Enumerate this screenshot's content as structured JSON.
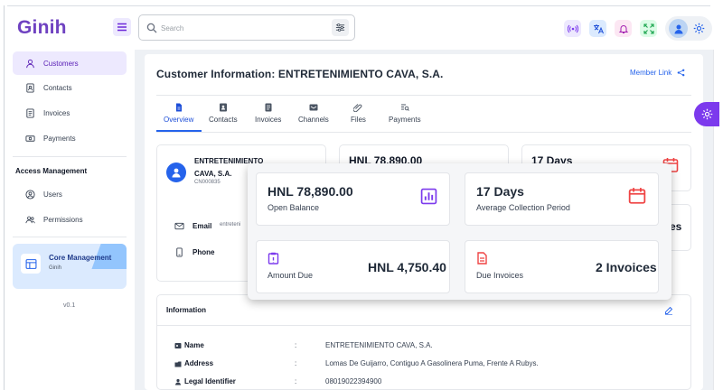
{
  "app": {
    "logo": "Ginih"
  },
  "header": {
    "search_placeholder": "Search",
    "icons": [
      "broadcast-icon",
      "translate-icon",
      "bell-icon",
      "fullscreen-icon",
      "user-icon",
      "gear-icon"
    ]
  },
  "sidebar": {
    "items": [
      {
        "label": "Customers",
        "icon": "person-icon",
        "active": true
      },
      {
        "label": "Contacts",
        "icon": "address-book-icon"
      },
      {
        "label": "Invoices",
        "icon": "document-icon"
      },
      {
        "label": "Payments",
        "icon": "cash-icon"
      }
    ],
    "section_title": "Access Management",
    "access_items": [
      {
        "label": "Users",
        "icon": "user-circle-icon"
      },
      {
        "label": "Permissions",
        "icon": "users-icon"
      }
    ],
    "core_card": {
      "title": "Core Management",
      "subtitle": "Ginih"
    },
    "version": "v0.1"
  },
  "page": {
    "title": "Customer Information: ENTRETENIMIENTO CAVA, S.A.",
    "member_link": "Member Link",
    "tabs": [
      {
        "label": "Overview",
        "active": true
      },
      {
        "label": "Contacts"
      },
      {
        "label": "Invoices"
      },
      {
        "label": "Channels"
      },
      {
        "label": "Files"
      },
      {
        "label": "Payments"
      }
    ]
  },
  "customer": {
    "name": "ENTRETENIMIENTO CAVA, S.A.",
    "code": "CN000835",
    "email_label": "Email",
    "email_value": "entreteni",
    "phone_label": "Phone"
  },
  "underlying": {
    "balance": "HNL 78,890.00",
    "days": "17 Days",
    "invoices_tail": "es"
  },
  "popup": {
    "open_balance": {
      "value": "HNL 78,890.00",
      "label": "Open Balance"
    },
    "collection": {
      "value": "17 Days",
      "label": "Average Collection Period"
    },
    "amount_due": {
      "value": "HNL 4,750.40",
      "label": "Amount Due"
    },
    "due_invoices": {
      "value": "2 Invoices",
      "label": "Due Invoices"
    }
  },
  "information": {
    "title": "Information",
    "rows": [
      {
        "label": "Name",
        "value": "ENTRETENIMIENTO CAVA, S.A."
      },
      {
        "label": "Address",
        "value": "Lomas De Guijarro, Contiguo A Gasolinera Puma, Frente A Rubys."
      },
      {
        "label": "Legal Identifier",
        "value": "08019022394900"
      }
    ],
    "colon": ":"
  },
  "colors": {
    "brand": "#6f42c1",
    "accent": "#2563eb",
    "popup_icon": "#7c3aed",
    "calendar": "#ef4444"
  }
}
